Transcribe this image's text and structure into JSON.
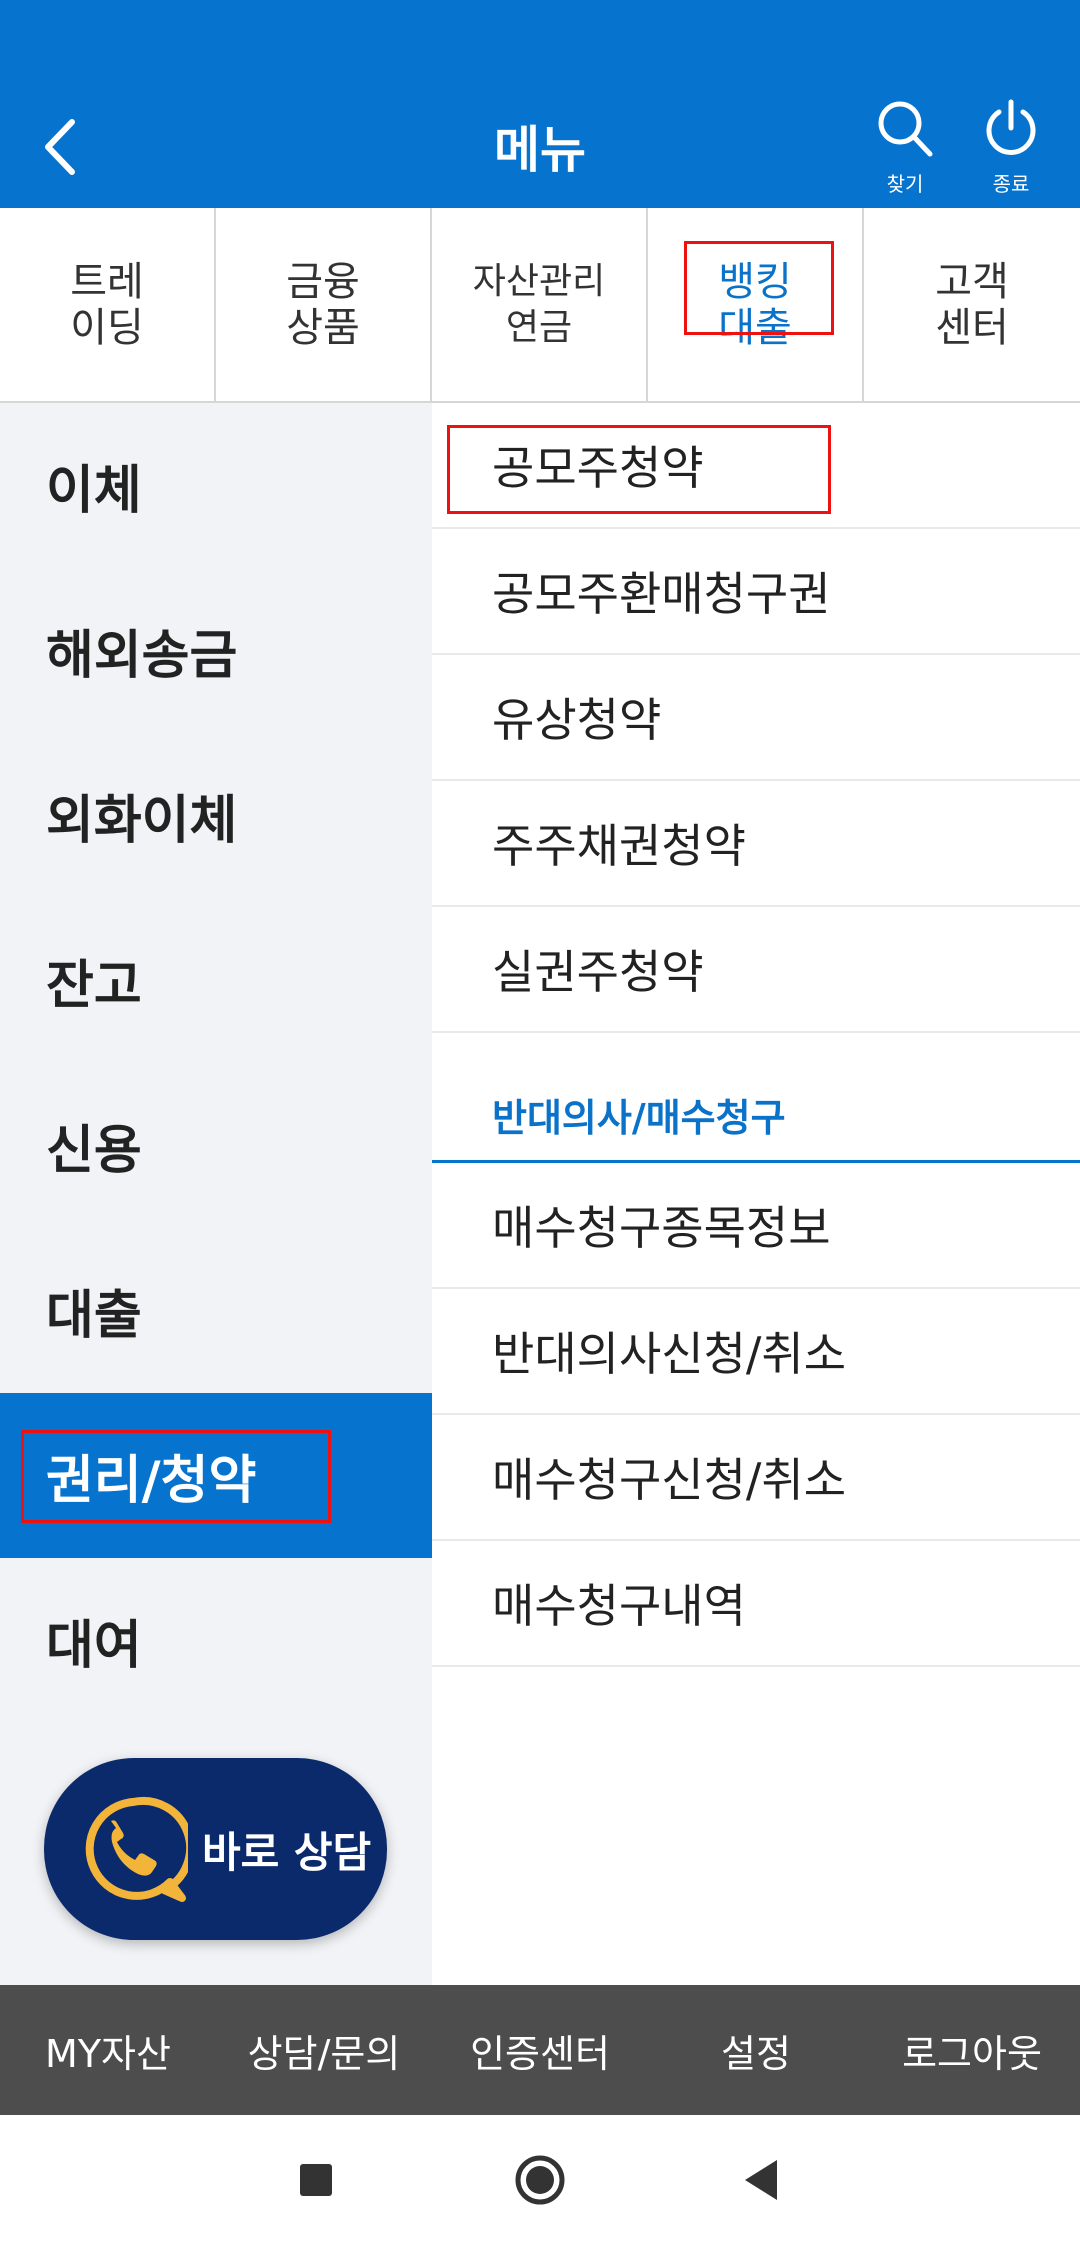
{
  "header": {
    "title": "메뉴",
    "search_label": "찾기",
    "exit_label": "종료"
  },
  "tabs": [
    {
      "label": "트레\n이딩"
    },
    {
      "label": "금융\n상품"
    },
    {
      "label": "자산관리\n연금"
    },
    {
      "label": "뱅킹\n대출",
      "active": true
    },
    {
      "label": "고객\n센터"
    }
  ],
  "leftnav": {
    "items": [
      {
        "label": "이체"
      },
      {
        "label": "해외송금"
      },
      {
        "label": "외화이체"
      },
      {
        "label": "잔고"
      },
      {
        "label": "신용"
      },
      {
        "label": "대출"
      },
      {
        "label": "권리/청약",
        "active": true
      },
      {
        "label": "대여"
      }
    ]
  },
  "fab": {
    "label": "바로 상담"
  },
  "submenu": {
    "items": [
      {
        "label": "공모주청약"
      },
      {
        "label": "공모주환매청구권"
      },
      {
        "label": "유상청약"
      },
      {
        "label": "주주채권청약"
      },
      {
        "label": "실권주청약"
      }
    ],
    "section_title": "반대의사/매수청구",
    "section_items": [
      {
        "label": "매수청구종목정보"
      },
      {
        "label": "반대의사신청/취소"
      },
      {
        "label": "매수청구신청/취소"
      },
      {
        "label": "매수청구내역"
      }
    ]
  },
  "bottombar": {
    "items": [
      {
        "label": "MY자산"
      },
      {
        "label": "상담/문의"
      },
      {
        "label": "인증센터"
      },
      {
        "label": "설정"
      },
      {
        "label": "로그아웃"
      }
    ]
  },
  "colors": {
    "primary": "#0673cf",
    "navy": "#0b2a6b",
    "highlight": "#e11111",
    "bottom_bar": "#4d4d4d"
  }
}
